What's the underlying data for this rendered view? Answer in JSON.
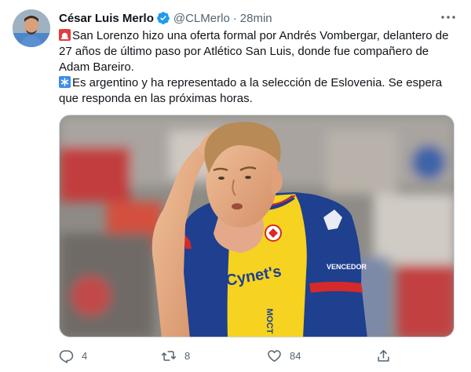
{
  "author": {
    "name": "César Luis Merlo",
    "handle": "@CLMerlo",
    "separator": "·",
    "time": "28min",
    "verified": true
  },
  "tweet": {
    "paragraphs": [
      {
        "emoji": "rotating-light-icon",
        "text": "San Lorenzo hizo una oferta formal por Andrés Vombergar, delantero de 27 años de último paso por Atlético San Luis, donde fue compañero de Adam Bareiro."
      },
      {
        "emoji": "asterisk-icon",
        "text": "Es argentino y ha representado a la selección de Eslovenia. Se espera que responda en las próximas horas."
      }
    ]
  },
  "media": {
    "jersey_text": {
      "chest_sponsor": "Cynet's",
      "sleeve_sponsor": "VENCEDOR",
      "side_sponsor": "MOCT Cemento"
    }
  },
  "actions": {
    "replies": "4",
    "retweets": "8",
    "likes": "84"
  },
  "colors": {
    "text_primary": "#0f1419",
    "text_secondary": "#536471",
    "verified_blue": "#1d9bf0",
    "jersey_blue": "#1f3f8f",
    "jersey_yellow": "#f5d320",
    "jersey_red": "#d52a2a"
  }
}
